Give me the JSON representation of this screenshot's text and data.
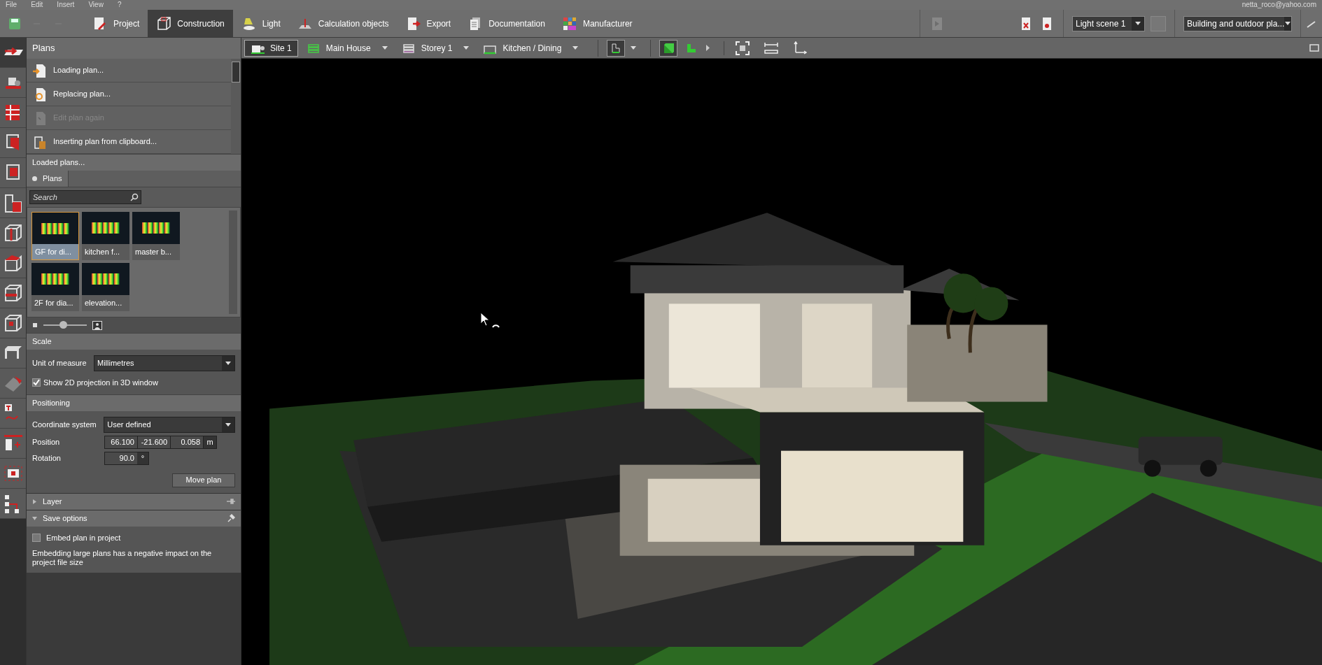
{
  "menu": [
    "File",
    "Edit",
    "Insert",
    "View",
    "?"
  ],
  "user_email": "netta_roco@yahoo.com",
  "ribbon_tabs": [
    {
      "label": "Project",
      "selected": false
    },
    {
      "label": "Construction",
      "selected": true
    },
    {
      "label": "Light",
      "selected": false
    },
    {
      "label": "Calculation objects",
      "selected": false
    },
    {
      "label": "Export",
      "selected": false
    },
    {
      "label": "Documentation",
      "selected": false
    },
    {
      "label": "Manufacturer",
      "selected": false
    }
  ],
  "light_scene": "Light scene 1",
  "view_mode": "Building and outdoor pla...",
  "view_toolbar": [
    {
      "label": "Site 1",
      "selected": true,
      "dropdown": false
    },
    {
      "label": "Main House",
      "selected": false,
      "dropdown": true
    },
    {
      "label": "Storey 1",
      "selected": false,
      "dropdown": true
    },
    {
      "label": "Kitchen / Dining",
      "selected": false,
      "dropdown": true
    }
  ],
  "plans": {
    "title": "Plans",
    "actions": [
      {
        "label": "Loading plan...",
        "disabled": false
      },
      {
        "label": "Replacing plan...",
        "disabled": false
      },
      {
        "label": "Edit plan again",
        "disabled": true
      },
      {
        "label": "Inserting plan from clipboard...",
        "disabled": false
      }
    ]
  },
  "loaded_plans": {
    "title": "Loaded plans...",
    "tab": "Plans",
    "search_placeholder": "Search",
    "thumbnails": [
      {
        "label": "GF for di...",
        "selected": true
      },
      {
        "label": "kitchen f...",
        "selected": false
      },
      {
        "label": "master b...",
        "selected": false
      },
      {
        "label": "2F for dia...",
        "selected": false
      },
      {
        "label": "elevation...",
        "selected": false
      }
    ],
    "size_slider": {
      "level": 0.45
    }
  },
  "scale": {
    "title": "Scale",
    "unit_label": "Unit of measure",
    "unit_value": "Millimetres",
    "projection": {
      "label": "Show 2D projection in 3D window",
      "checked": true
    }
  },
  "positioning": {
    "title": "Positioning",
    "coord_label": "Coordinate system",
    "coord_value": "User defined",
    "position_label": "Position",
    "position_values": [
      "66.100",
      "-21.600",
      "0.058"
    ],
    "position_unit": "m",
    "rotation_label": "Rotation",
    "rotation_value": "90.0",
    "rotation_unit": "°",
    "button": "Move plan"
  },
  "layer": {
    "title": "Layer",
    "expanded": false
  },
  "save_options": {
    "title": "Save options",
    "expanded": true,
    "embed": {
      "label": "Embed plan in project",
      "checked": false
    },
    "note": "Embedding large plans has a negative impact on the project file size"
  }
}
